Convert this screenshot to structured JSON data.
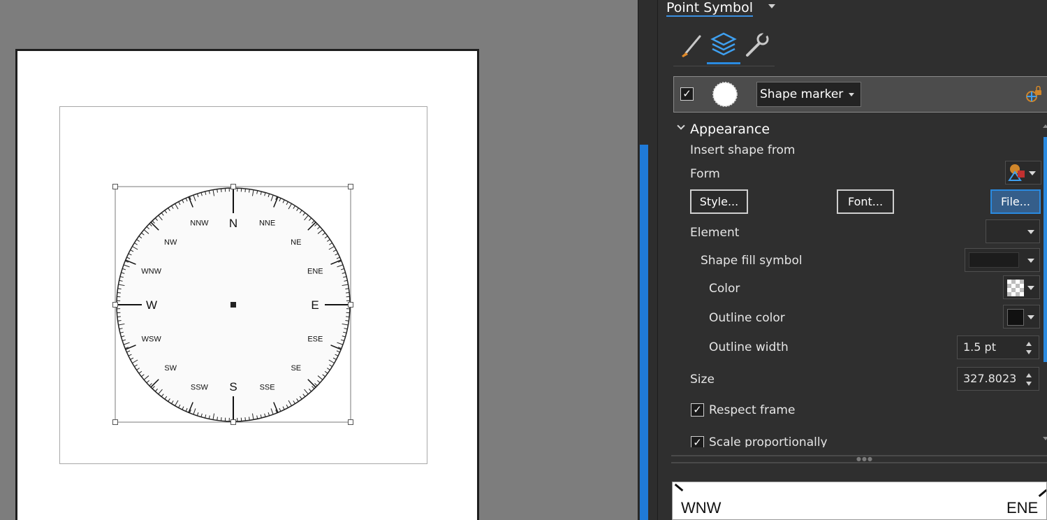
{
  "compass": {
    "cardinals": [
      "N",
      "E",
      "S",
      "W"
    ],
    "intercardinals": [
      "NNE",
      "NE",
      "ENE",
      "ESE",
      "SE",
      "SSE",
      "SSW",
      "SW",
      "WSW",
      "WNW",
      "NW",
      "NNW"
    ]
  },
  "pane": {
    "title": "Point Symbol",
    "tabs": [
      {
        "name": "properties",
        "icon": "brush-icon"
      },
      {
        "name": "layers",
        "icon": "layers-icon"
      },
      {
        "name": "settings",
        "icon": "wrench-icon"
      }
    ],
    "layer": {
      "checked": "✓",
      "type": "Shape marker",
      "lock_icon": "lock-icon"
    },
    "appearance": {
      "section_title": "Appearance",
      "insert_shape_from": "Insert shape from",
      "form_label": "Form",
      "style_button": "Style...",
      "font_button": "Font...",
      "file_button": "File...",
      "element_label": "Element",
      "shape_fill_label": "Shape fill symbol",
      "color_label": "Color",
      "outline_color_label": "Outline color",
      "outline_width_label": "Outline width",
      "outline_width_value": "1.5 pt",
      "size_label": "Size",
      "size_value": "327.8023",
      "respect_frame_label": "Respect frame",
      "respect_frame_check": "✓",
      "scale_label": "Scale proportionally",
      "scale_check": "✓"
    },
    "preview": {
      "left_text": "WNW",
      "right_text": "ENE"
    }
  },
  "colors": {
    "accent": "#2a8ae0",
    "pane_bg": "#2f2f2f",
    "canvas_bg": "#7d7d7d"
  }
}
